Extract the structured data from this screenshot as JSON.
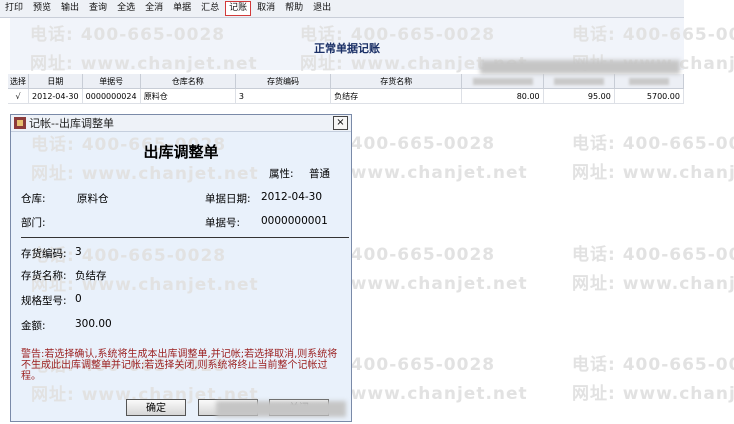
{
  "toolbar": {
    "items": [
      "打印",
      "预览",
      "输出",
      "查询",
      "全选",
      "全消",
      "单据",
      "汇总",
      "记账",
      "取消",
      "帮助",
      "退出"
    ],
    "active_index": 8
  },
  "watermark": {
    "phone": "电话: 400-665-0028",
    "site": "网址: www.chanjet.net"
  },
  "page": {
    "title": "正常单据记账"
  },
  "table": {
    "columns": [
      "选择",
      "日期",
      "单据号",
      "仓库名称",
      "",
      "存货编码",
      "存货名称"
    ],
    "rows": [
      {
        "select": "√",
        "date": "2012-04-30",
        "doc_no": "0000000024",
        "warehouse": "原料仓",
        "code": "3",
        "name": "负结存",
        "v1": "80.00",
        "v2": "95.00",
        "v3": "5700.00"
      }
    ]
  },
  "dialog": {
    "title": "记帐--出库调整单",
    "close": "×",
    "heading": "出库调整单",
    "attribute_label": "属性:",
    "attribute_value": "普通",
    "warehouse_label": "仓库:",
    "warehouse_value": "原料仓",
    "date_label": "单据日期:",
    "date_value": "2012-04-30",
    "dept_label": "部门:",
    "docno_label": "单据号:",
    "docno_value": "0000000001",
    "code_label": "存货编码:",
    "code_value": "3",
    "name_label": "存货名称:",
    "name_value": "负结存",
    "spec_label": "规格型号:",
    "spec_value": "0",
    "amount_label": "金额:",
    "amount_value": "300.00",
    "warning": "警告:若选择确认,系统将生成本出库调整单,并记帐;若选择取消,则系统将不生成此出库调整单并记帐;若选择关闭,则系统将终止当前整个记帐过程。",
    "ok_label": "确定",
    "close_label": "关闭"
  }
}
